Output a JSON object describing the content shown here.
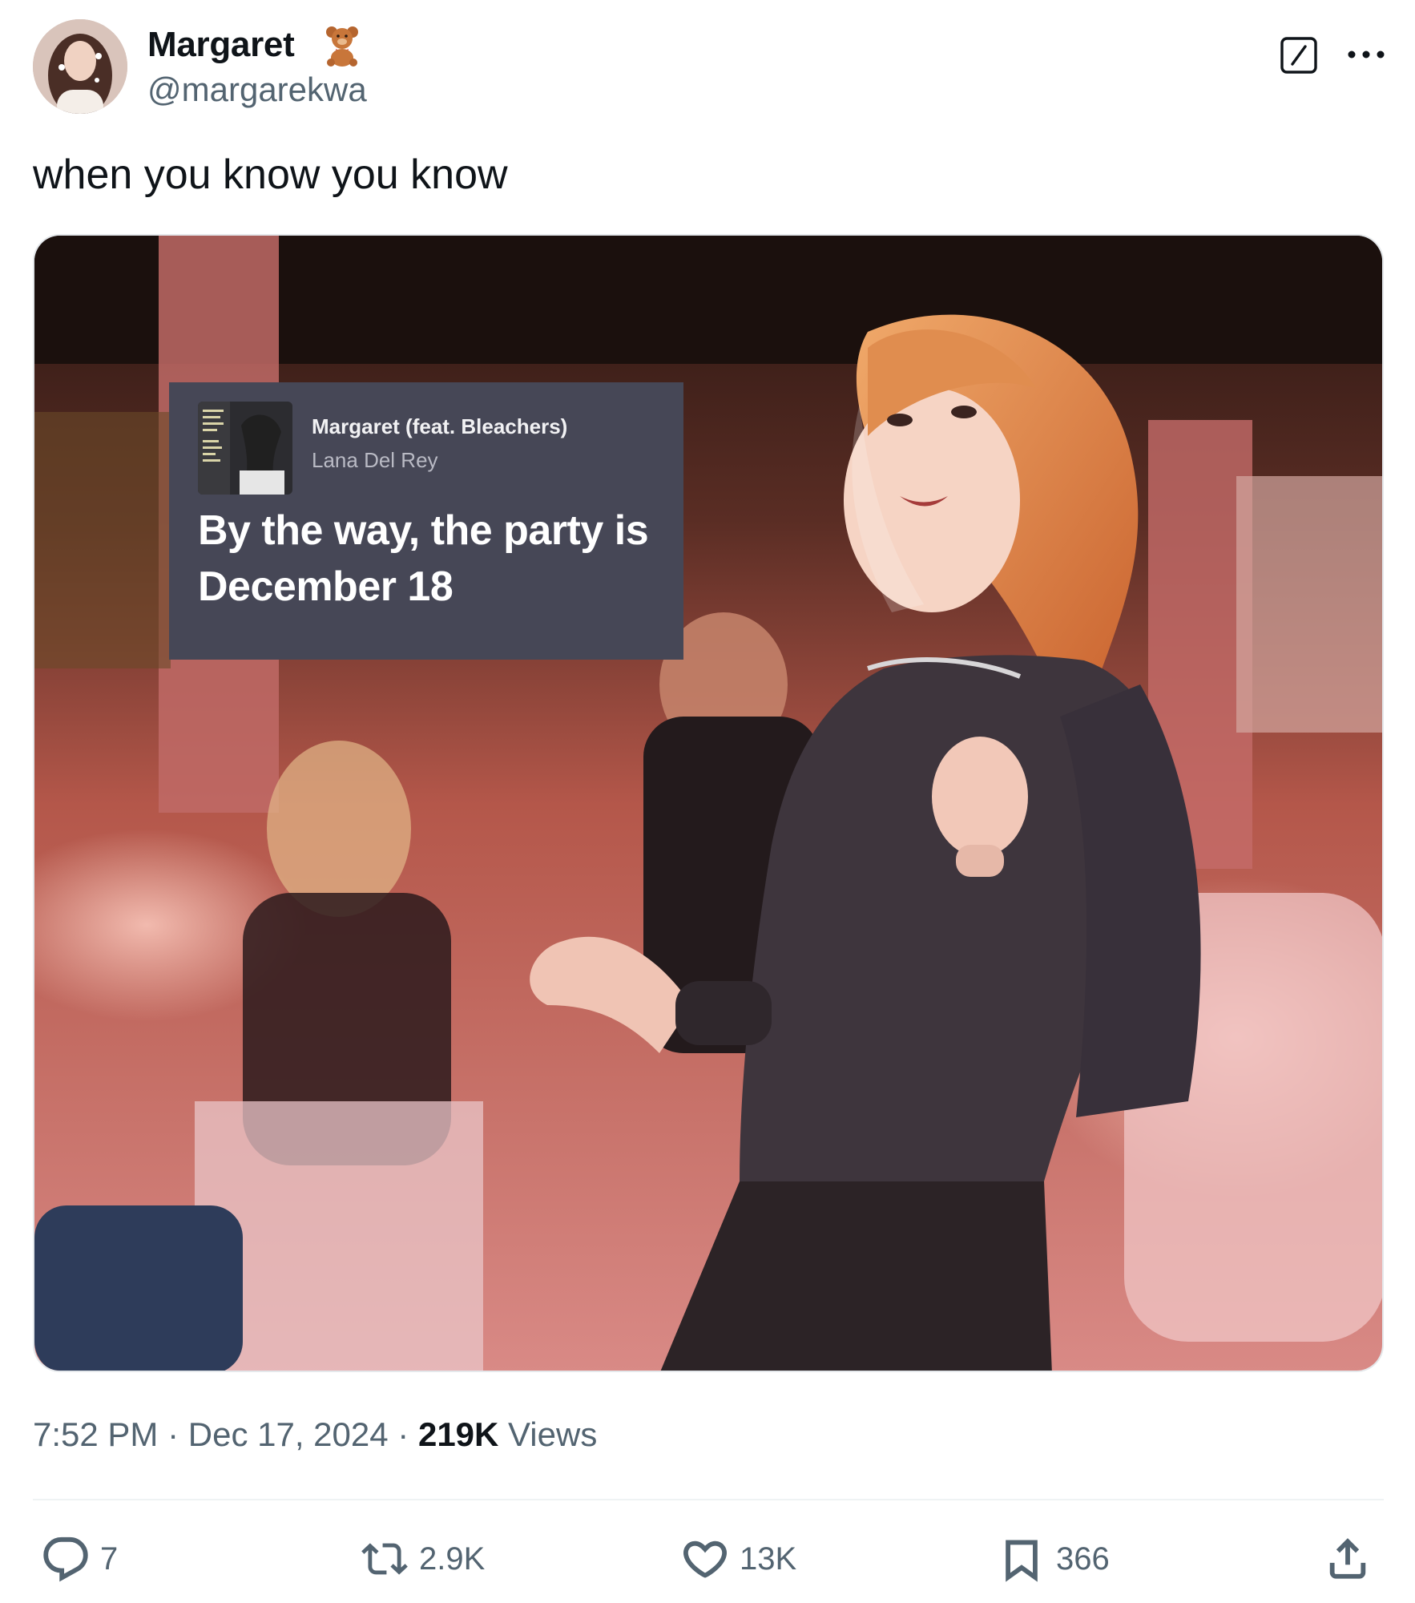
{
  "author": {
    "display_name": "Margaret",
    "handle": "@margarekwa",
    "emoji_icon": "teddy-bear-icon"
  },
  "tweet": {
    "text": "when you know you know"
  },
  "media": {
    "lyric_card": {
      "song_title": "Margaret (feat. Bleachers)",
      "artist": "Lana Del Rey",
      "lyric": "By the way, the party is December 18"
    }
  },
  "meta": {
    "time": "7:52 PM",
    "separator": "·",
    "date": "Dec 17, 2024",
    "views_count": "219K",
    "views_label": "Views"
  },
  "actions": {
    "replies": "7",
    "reposts": "2.9K",
    "likes": "13K",
    "bookmarks": "366"
  },
  "colors": {
    "text_primary": "#0f1419",
    "text_secondary": "#536471",
    "lyric_card_bg": "#464756",
    "divider": "#eff3f4"
  }
}
